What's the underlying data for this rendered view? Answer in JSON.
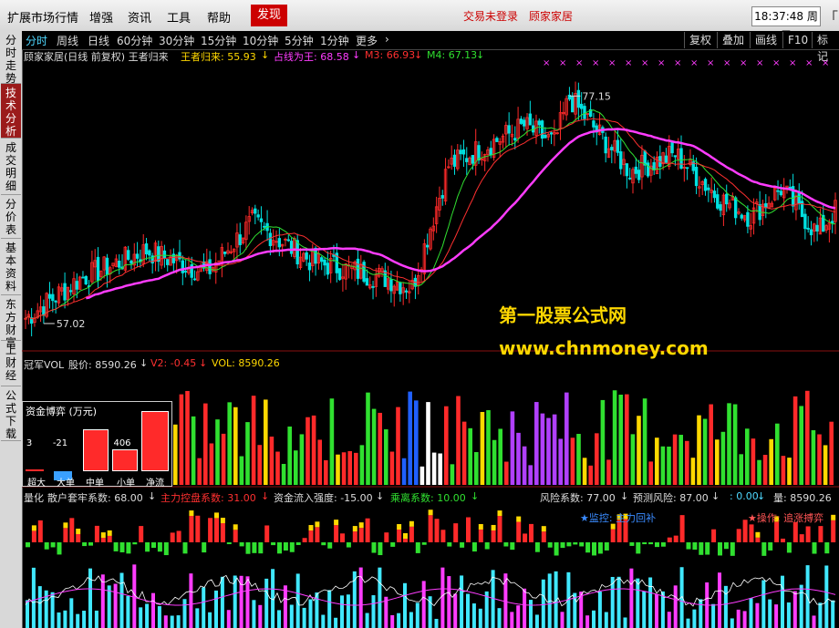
{
  "menubar": {
    "items": [
      "扩展市场行情",
      "增强",
      "资讯",
      "工具",
      "帮助"
    ],
    "hot_button": "发现",
    "login_status": "交易未登录",
    "user_name": "顾家家居",
    "time": "18:37:48",
    "weekday": "周二",
    "window_chevron": "「"
  },
  "side_tabs": [
    {
      "label": "分时走势",
      "active": false
    },
    {
      "label": "技术分析",
      "active": true
    },
    {
      "label": "成交明细",
      "active": false
    },
    {
      "label": "分价表",
      "active": false
    },
    {
      "label": "基本资料",
      "active": false
    },
    {
      "label": "东方财富",
      "active": false
    },
    {
      "label": "上财经",
      "active": false
    },
    {
      "label": "公式下载",
      "active": false
    }
  ],
  "period_tabs": {
    "items": [
      "分时",
      "周线",
      "日线",
      "60分钟",
      "30分钟",
      "15分钟",
      "10分钟",
      "5分钟",
      "1分钟",
      "更多"
    ],
    "active": "分时",
    "more_arrow": "›"
  },
  "toolbar_right": [
    "复权",
    "叠加",
    "画线",
    "F10",
    "标记"
  ],
  "main_indicator": {
    "title": "顾家家居(日线 前复权) 王者归来",
    "wz_label": "王者归来: 55.93",
    "zx_label": "占线为王: 68.58",
    "m3_label": "M3: 66.93",
    "m4_label": "M4: 67.13",
    "down_arrow": "↓",
    "high_label": "77.15",
    "low_label": "57.02",
    "chart_data": {
      "type": "candlestick",
      "title": "顾家家居(日线 前复权) 王者归来",
      "ylim": [
        55,
        80
      ],
      "high_mark": 77.15,
      "low_mark": 57.02,
      "series_names": [
        "王者归来",
        "占线为王",
        "M3",
        "M4"
      ],
      "series_last": [
        55.93,
        68.58,
        66.93,
        67.13
      ]
    }
  },
  "volume_indicator": {
    "title": "冠军VOL",
    "label1": "股价: 8590.26",
    "label2": "V2: -0.45",
    "label3": "VOL: 8590.26",
    "down_arrow": "↓"
  },
  "fund_box": {
    "title": "资金博弈 (万元)",
    "values": [
      "3",
      "-21",
      "855",
      "406",
      "1244"
    ],
    "labels": [
      "超大",
      "大单",
      "中单",
      "小单",
      "净流"
    ],
    "numbers": [
      3,
      -21,
      855,
      406,
      1244
    ]
  },
  "lower_indicator": {
    "labels": [
      "量化",
      "散户套牢系数: 68.00",
      "主力控盘系数: 31.00",
      "资金流入强度: -15.00",
      "乘离系数: 10.00",
      "风险系数: 77.00",
      "预测风险: 87.00",
      ": 0.00",
      "量: 8590.26"
    ],
    "down_arrow": "↓",
    "monitor_text": "★监控: 主力回补",
    "operate_text": "★操作: 追涨搏弈"
  },
  "watermark": {
    "line1": "第一股票公式网",
    "line2": "www.chnmoney.com"
  },
  "colors": {
    "up": "#ff2a2a",
    "down": "#00e0e0",
    "accent": "#ffd800",
    "ma_magenta": "#ff3cff",
    "ma_green": "#30e030",
    "ma_red": "#ff3030",
    "header_red": "#cc0000"
  }
}
